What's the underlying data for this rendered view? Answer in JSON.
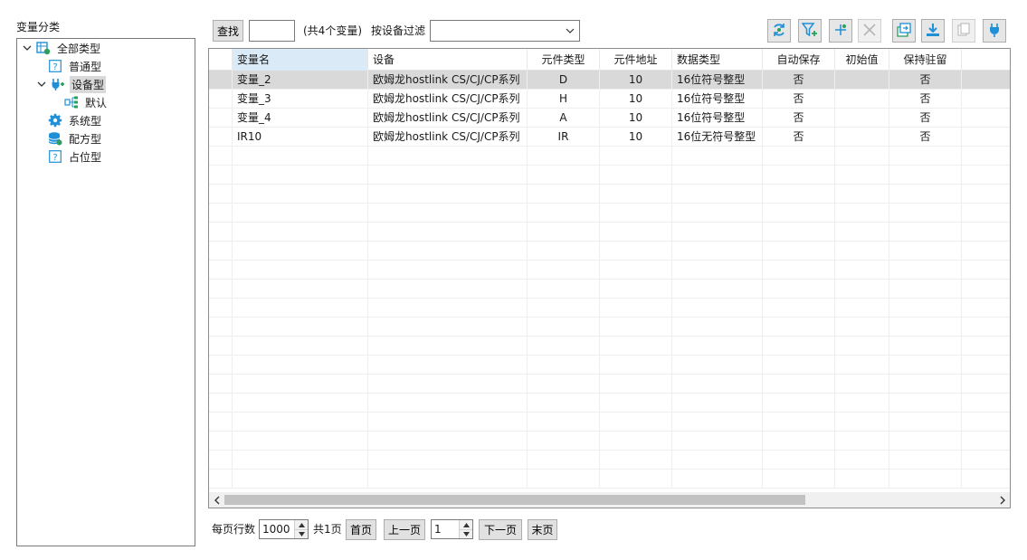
{
  "sidebar": {
    "title": "变量分类",
    "tree": [
      {
        "label": "全部类型",
        "icon": "table-gear-icon"
      },
      {
        "label": "普通型",
        "icon": "question-box-icon"
      },
      {
        "label": "设备型",
        "icon": "plug-icon"
      },
      {
        "label": "默认",
        "icon": "tree-node-icon"
      },
      {
        "label": "系统型",
        "icon": "gear-icon"
      },
      {
        "label": "配方型",
        "icon": "database-icon"
      },
      {
        "label": "占位型",
        "icon": "question-box-icon"
      }
    ]
  },
  "toolbar": {
    "search_label": "查找",
    "search_value": "",
    "count_text": "(共4个变量)",
    "filter_label": "按设备过滤",
    "filter_value": "",
    "icons": [
      "refresh-icon",
      "filter-add-icon",
      "add-variable-icon",
      "delete-icon",
      "export-icon",
      "download-icon",
      "copy-icon",
      "connect-icon"
    ]
  },
  "table": {
    "columns": [
      "变量名",
      "设备",
      "元件类型",
      "元件地址",
      "数据类型",
      "自动保存",
      "初始值",
      "保持驻留"
    ],
    "rows": [
      [
        "变量_2",
        "欧姆龙hostlink CS/CJ/CP系列",
        "D",
        "10",
        "16位符号整型",
        "否",
        "",
        "否"
      ],
      [
        "变量_3",
        "欧姆龙hostlink CS/CJ/CP系列",
        "H",
        "10",
        "16位符号整型",
        "否",
        "",
        "否"
      ],
      [
        "变量_4",
        "欧姆龙hostlink CS/CJ/CP系列",
        "A",
        "10",
        "16位符号整型",
        "否",
        "",
        "否"
      ],
      [
        "IR10",
        "欧姆龙hostlink CS/CJ/CP系列",
        "IR",
        "10",
        "16位无符号整型",
        "否",
        "",
        "否"
      ]
    ],
    "selected_row": 0
  },
  "pager": {
    "rows_per_page_label": "每页行数",
    "rows_per_page": "1000",
    "total_pages": "共1页",
    "first_label": "首页",
    "prev_label": "上一页",
    "page_value": "1",
    "next_label": "下一页",
    "last_label": "末页"
  },
  "colors": {
    "accent": "#1e90d8",
    "green": "#2aa05a",
    "selected_row": "#d9d9d9",
    "header_active": "#dbeaf7"
  }
}
